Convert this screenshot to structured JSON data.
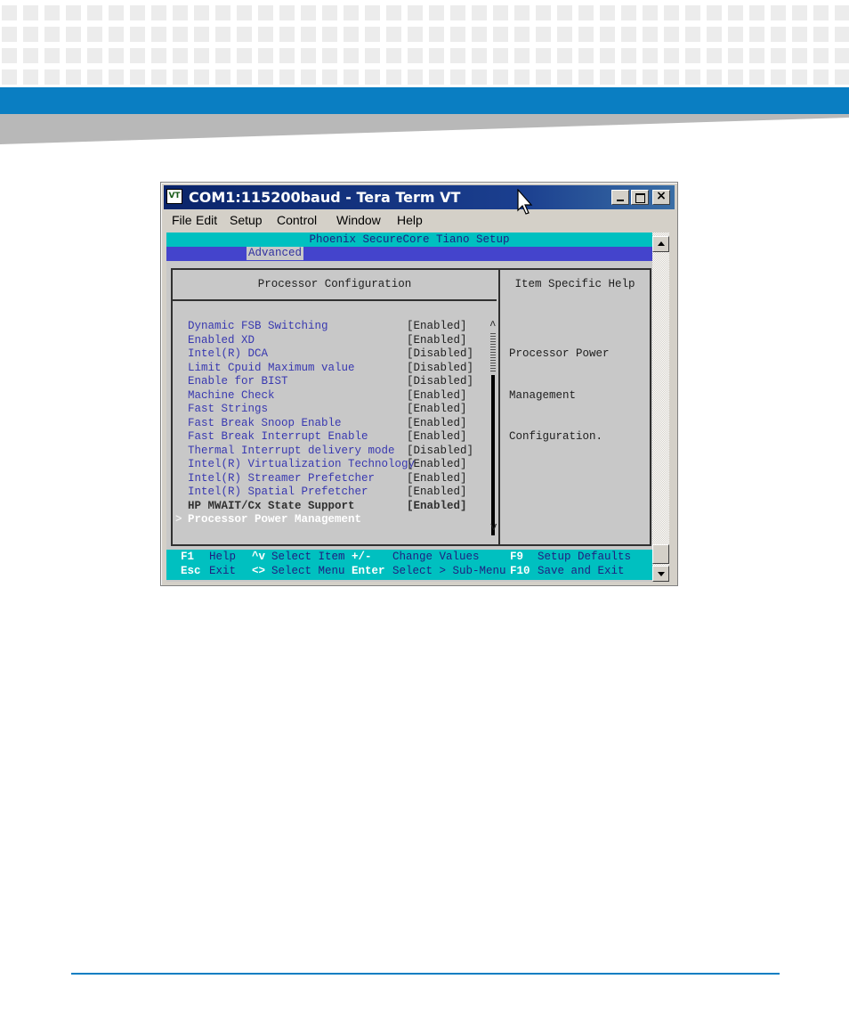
{
  "window": {
    "title": "COM1:115200baud - Tera Term VT",
    "icon": "teraterm-vt-icon",
    "menu": [
      "File",
      "Edit",
      "Setup",
      "Control",
      "Window",
      "Help"
    ]
  },
  "bios": {
    "title": "Phoenix SecureCore Tiano Setup",
    "active_tab": "Advanced",
    "section_title": "Processor Configuration",
    "help_title": "Item Specific Help",
    "items": [
      {
        "label": "Dynamic FSB Switching",
        "value": "[Enabled]"
      },
      {
        "label": "Enabled XD",
        "value": "[Enabled]"
      },
      {
        "label": "Intel(R) DCA",
        "value": "[Disabled]"
      },
      {
        "label": "Limit Cpuid Maximum value",
        "value": "[Disabled]"
      },
      {
        "label": "Enable for BIST",
        "value": "[Disabled]"
      },
      {
        "label": "Machine Check",
        "value": "[Enabled]"
      },
      {
        "label": "Fast Strings",
        "value": "[Enabled]"
      },
      {
        "label": "Fast Break Snoop Enable",
        "value": "[Enabled]"
      },
      {
        "label": "Fast Break Interrupt Enable",
        "value": "[Enabled]"
      },
      {
        "label": "Thermal Interrupt delivery mode",
        "value": "[Disabled]"
      },
      {
        "label": "Intel(R) Virtualization Technology",
        "value": "[Enabled]"
      },
      {
        "label": "Intel(R) Streamer Prefetcher",
        "value": "[Enabled]"
      },
      {
        "label": "Intel(R) Spatial Prefetcher",
        "value": "[Enabled]"
      },
      {
        "label": "HP MWAIT/Cx State Support",
        "value": "[Enabled]"
      }
    ],
    "submenu_marker": ">",
    "selected_item": "Processor Power Management",
    "help_lines": [
      "Processor Power",
      "Management",
      "Configuration."
    ],
    "scroll_up_glyph": "^",
    "scroll_down_glyph": "v",
    "footer": {
      "row1": [
        {
          "key": "F1",
          "desc": "Help"
        },
        {
          "key": "^v",
          "desc": "Select Item"
        },
        {
          "key": "+/-",
          "desc": "Change Values"
        },
        {
          "key": "F9",
          "desc": "Setup Defaults"
        }
      ],
      "row2": [
        {
          "key": "Esc",
          "desc": "Exit"
        },
        {
          "key": "<>",
          "desc": "Select Menu"
        },
        {
          "key": "Enter",
          "desc": "Select > Sub-Menu"
        },
        {
          "key": "F10",
          "desc": "Save and Exit"
        }
      ]
    }
  },
  "colors": {
    "brand_blue": "#0a7ec2",
    "title_bar": "#0a246a",
    "bios_cyan": "#00c0c0",
    "bios_blue": "#4444cc",
    "item_text": "#3838b0"
  }
}
